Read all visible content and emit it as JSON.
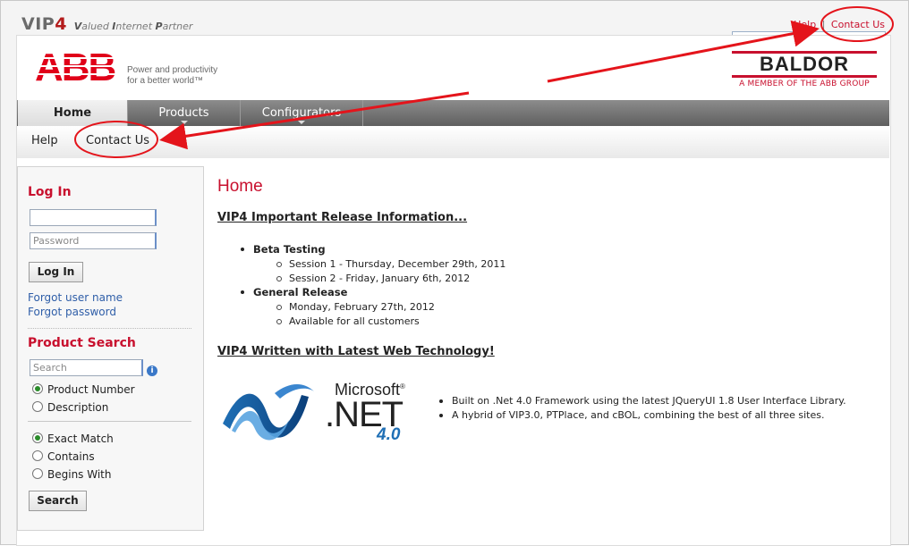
{
  "header": {
    "logo_main": "VIP",
    "logo_num": "4",
    "logo_tagline_parts": [
      "V",
      "alued ",
      "I",
      "nternet ",
      "P",
      "artner"
    ],
    "help_link": "Help",
    "separator": "|",
    "contact_link": "Contact Us"
  },
  "brand": {
    "abb_text": "ABB",
    "abb_tagline_1": "Power and productivity",
    "abb_tagline_2": "for a better world™",
    "baldor_name": "BALDOR",
    "baldor_member": "A MEMBER OF THE ABB GROUP"
  },
  "nav": {
    "tabs": [
      {
        "label": "Home",
        "active": true
      },
      {
        "label": "Products",
        "active": false
      },
      {
        "label": "Configurators",
        "active": false
      }
    ],
    "subnav": [
      "Help",
      "Contact Us"
    ]
  },
  "sidebar": {
    "login_title": "Log In",
    "username_placeholder": "",
    "password_placeholder": "Password",
    "login_button": "Log In",
    "forgot_user": "Forgot user name",
    "forgot_password": "Forgot password",
    "search_title": "Product Search",
    "search_placeholder": "Search",
    "info_glyph": "i",
    "search_type_options": [
      {
        "label": "Product Number",
        "checked": true
      },
      {
        "label": "Description",
        "checked": false
      }
    ],
    "match_options": [
      {
        "label": "Exact Match",
        "checked": true
      },
      {
        "label": "Contains",
        "checked": false
      },
      {
        "label": "Begins With",
        "checked": false
      }
    ],
    "search_button": "Search"
  },
  "main": {
    "title": "Home",
    "section1_title": "VIP4 Important Release Information...",
    "beta_label": "Beta Testing",
    "beta_sessions": [
      "Session 1 - Thursday, December 29th, 2011",
      "Session 2 - Friday, January 6th, 2012"
    ],
    "general_label": "General Release",
    "general_items": [
      "Monday, February 27th, 2012",
      "Available for all customers"
    ],
    "section2_title": "VIP4 Written with Latest Web Technology!",
    "net_microsoft": "Microsoft",
    "net_reg": "®",
    "net_name": ".NET",
    "net_version": "4.0",
    "tech_items": [
      "Built on .Net 4.0 Framework using the latest JQueryUI 1.8 User Interface Library.",
      "A hybrid of VIP3.0, PTPlace, and cBOL, combining the best of all three sites."
    ]
  },
  "colors": {
    "accent_red": "#c8102e",
    "link_blue": "#2f5ea8",
    "nav_gray": "#6f6f6f"
  }
}
